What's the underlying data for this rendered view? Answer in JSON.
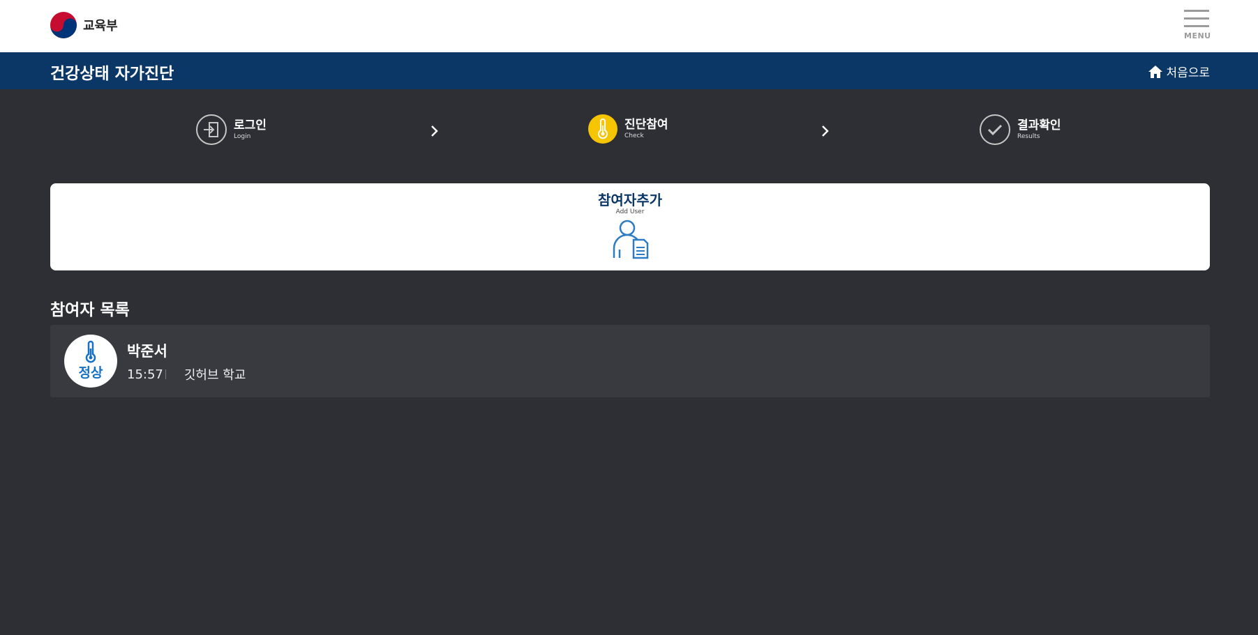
{
  "header": {
    "logo_text": "교육부",
    "menu_label": "MENU"
  },
  "titlebar": {
    "title": "건강상태 자가진단",
    "home_label": "처음으로"
  },
  "steps": [
    {
      "ko": "로그인",
      "en": "Login",
      "icon": "login-icon",
      "state": "done"
    },
    {
      "ko": "진단참여",
      "en": "Check",
      "icon": "thermometer-icon",
      "state": "active"
    },
    {
      "ko": "결과확인",
      "en": "Results",
      "icon": "check-icon",
      "state": "pending"
    }
  ],
  "add_user": {
    "title": "참여자추가",
    "subtitle": "Add User",
    "icon": "user-document-icon"
  },
  "participants": {
    "title": "참여자 목록",
    "items": [
      {
        "name": "박준서",
        "status": "정상",
        "time": "15:57",
        "school": "깃허브 학교"
      }
    ]
  },
  "colors": {
    "navy": "#0a3766",
    "background": "#2d2f34",
    "active_step": "#f6c501",
    "status_blue": "#1670c4"
  }
}
